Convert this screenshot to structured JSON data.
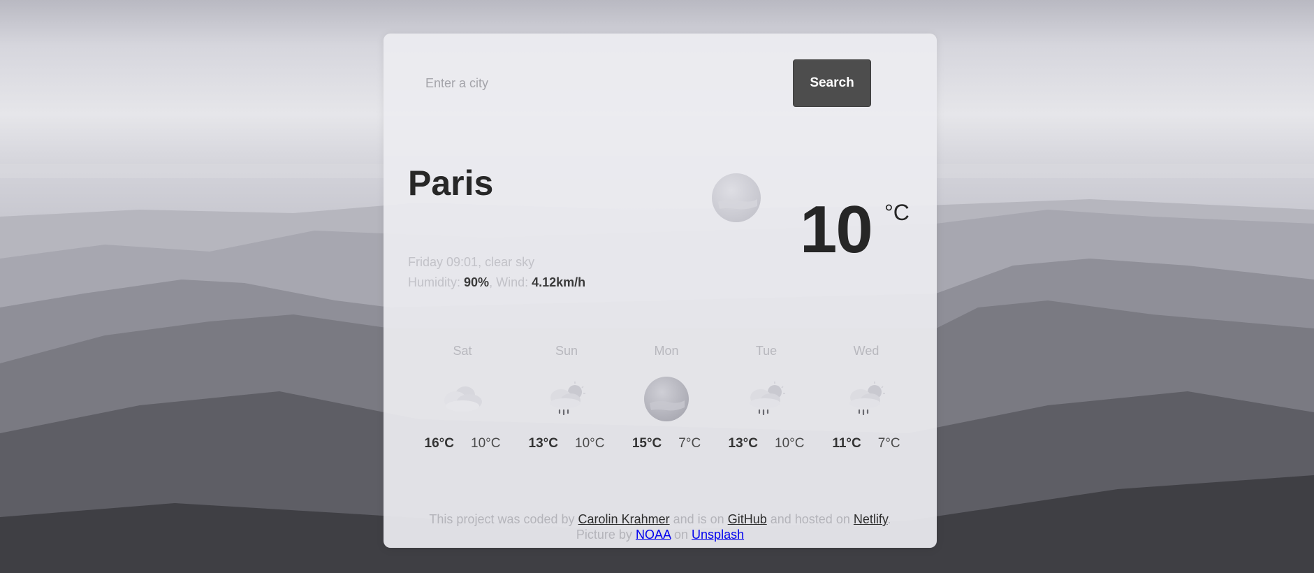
{
  "search": {
    "placeholder": "Enter a city",
    "button_label": "Search"
  },
  "current": {
    "city": "Paris",
    "day_time": "Friday 09:01",
    "description": "clear sky",
    "humidity_label": "Humidity:",
    "humidity": "90%",
    "wind_label": "Wind:",
    "wind": "4.12km/h",
    "temperature": "10",
    "unit": "°C",
    "icon": "clear-sky-icon"
  },
  "forecast": [
    {
      "day": "Sat",
      "icon": "clouds-icon",
      "max": "16°C",
      "min": "10°C"
    },
    {
      "day": "Sun",
      "icon": "rain-icon",
      "max": "13°C",
      "min": "10°C"
    },
    {
      "day": "Mon",
      "icon": "clear-sky-icon",
      "max": "15°C",
      "min": "7°C"
    },
    {
      "day": "Tue",
      "icon": "rain-icon",
      "max": "13°C",
      "min": "10°C"
    },
    {
      "day": "Wed",
      "icon": "rain-icon",
      "max": "11°C",
      "min": "7°C"
    }
  ],
  "footer": {
    "text1": "This project was coded by",
    "author": "Carolin Krahmer",
    "text2": "and is on",
    "github": "GitHub",
    "text3": "and hosted on",
    "netlify": "Netlify",
    "text4": ".",
    "text5": "Picture by",
    "noaa": "NOAA",
    "text6": "on",
    "unsplash": "Unsplash"
  }
}
